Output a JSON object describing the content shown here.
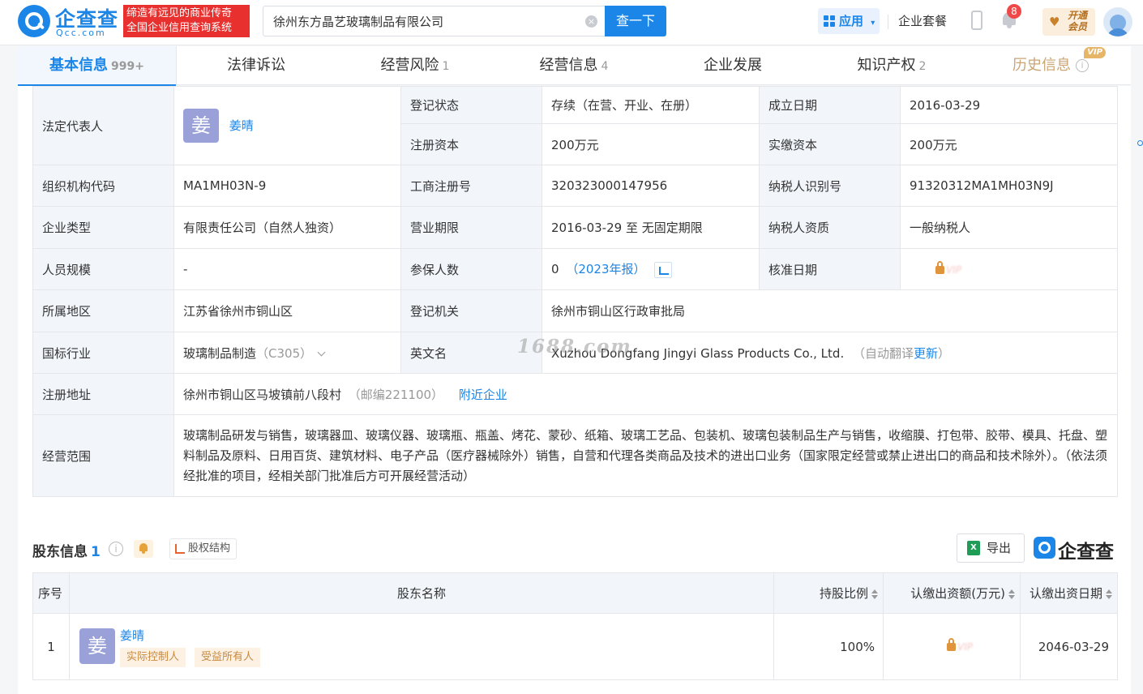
{
  "header": {
    "logo_cn": "企查查",
    "logo_en": "Qcc.com",
    "slogan_line1": "缔造有远见的商业传奇",
    "slogan_line2": "全国企业信用查询系统",
    "search_value": "徐州东方晶艺玻璃制品有限公司",
    "search_button": "查一下",
    "app_label": "应用",
    "suite_label": "企业套餐",
    "notification_count": "8",
    "vip_label_1": "开通",
    "vip_label_2": "会员"
  },
  "tabs": [
    {
      "label": "基本信息",
      "count": "999+"
    },
    {
      "label": "法律诉讼",
      "count": ""
    },
    {
      "label": "经营风险",
      "count": "1"
    },
    {
      "label": "经营信息",
      "count": "4"
    },
    {
      "label": "企业发展",
      "count": ""
    },
    {
      "label": "知识产权",
      "count": "2"
    },
    {
      "label": "历史信息",
      "count": "",
      "vip_tag": "VIP"
    }
  ],
  "basic": {
    "legal_rep_label": "法定代表人",
    "legal_rep_avatar": "姜",
    "legal_rep_name": "姜晴",
    "status_label": "登记状态",
    "status_value": "存续（在营、开业、在册）",
    "founded_label": "成立日期",
    "founded_value": "2016-03-29",
    "reg_capital_label": "注册资本",
    "reg_capital_value": "200万元",
    "paid_capital_label": "实缴资本",
    "paid_capital_value": "200万元",
    "org_code_label": "组织机构代码",
    "org_code_value": "MA1MH03N-9",
    "biz_reg_label": "工商注册号",
    "biz_reg_value": "320323000147956",
    "taxpayer_id_label": "纳税人识别号",
    "taxpayer_id_value": "91320312MA1MH03N9J",
    "type_label": "企业类型",
    "type_value": "有限责任公司（自然人独资）",
    "term_label": "营业期限",
    "term_value": "2016-03-29 至 无固定期限",
    "taxpayer_qual_label": "纳税人资质",
    "taxpayer_qual_value": "一般纳税人",
    "staff_label": "人员规模",
    "staff_value": "-",
    "insured_label": "参保人数",
    "insured_value": "0",
    "insured_year": "（2023年报）",
    "approve_label": "核准日期",
    "approve_lock": "VIP",
    "region_label": "所属地区",
    "region_value": "江苏省徐州市铜山区",
    "authority_label": "登记机关",
    "authority_value": "徐州市铜山区行政审批局",
    "industry_label": "国标行业",
    "industry_value": "玻璃制品制造",
    "industry_code": "（C305）",
    "english_label": "英文名",
    "english_value": "Xuzhou Dongfang Jingyi Glass Products Co., Ltd.",
    "english_note_pre": "（自动翻译",
    "english_note_link": "更新",
    "english_note_post": "）",
    "address_label": "注册地址",
    "address_value": "徐州市铜山区马坡镇前八段村",
    "address_zip": "（邮编221100）",
    "address_link": "附近企业",
    "scope_label": "经营范围",
    "scope_value": "玻璃制品研发与销售，玻璃器皿、玻璃仪器、玻璃瓶、瓶盖、烤花、蒙砂、纸箱、玻璃工艺品、包装机、玻璃包装制品生产与销售，收缩膜、打包带、胶带、模具、托盘、塑料制品及原料、日用百货、建筑材料、电子产品（医疗器械除外）销售，自营和代理各类商品及技术的进出口业务（国家限定经营或禁止进出口的商品和技术除外）。（依法须经批准的项目，经相关部门批准后方可开展经营活动）",
    "watermark": "1688.com"
  },
  "shareholders": {
    "title": "股东信息",
    "count": "1",
    "equity_label": "股权结构",
    "export_label": "导出",
    "brand": "企查查",
    "columns": [
      "序号",
      "股东名称",
      "持股比例",
      "认缴出资额(万元)",
      "认缴出资日期"
    ],
    "rows": [
      {
        "index": "1",
        "avatar": "姜",
        "name": "姜晴",
        "tags": [
          "实际控制人",
          "受益所有人"
        ],
        "ratio": "100%",
        "amount_lock": "VIP",
        "date": "2046-03-29"
      }
    ]
  }
}
